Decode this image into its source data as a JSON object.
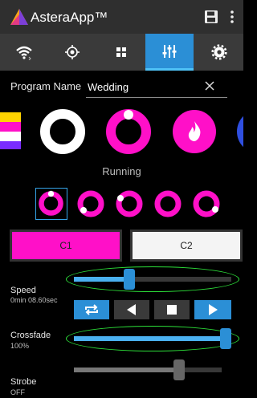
{
  "app": {
    "title": "AsteraApp™"
  },
  "tabs": [
    {
      "name": "wifi-icon"
    },
    {
      "name": "target-icon"
    },
    {
      "name": "grid-icon"
    },
    {
      "name": "sliders-icon",
      "active": true
    },
    {
      "name": "gear-icon"
    }
  ],
  "program": {
    "label": "Program Name",
    "value": "Wedding"
  },
  "status": "Running",
  "cue_buttons": [
    {
      "label": "C1",
      "color": "#ff10c8"
    },
    {
      "label": "C2",
      "color": "#f4f4f4"
    }
  ],
  "speed": {
    "label": "Speed",
    "value_text": "0min 08.60sec",
    "level": 0.34
  },
  "transport": [
    "loop-icon",
    "previous-icon",
    "stop-icon",
    "play-icon"
  ],
  "crossfade": {
    "label": "Crossfade",
    "value_text": "100%",
    "level": 1.0
  },
  "strobe": {
    "label": "Strobe",
    "value_text": "OFF",
    "level": 0.73
  },
  "colors": {
    "magenta": "#ff10c8",
    "accent": "#2b8fd6",
    "highlight": "#2de23a"
  }
}
